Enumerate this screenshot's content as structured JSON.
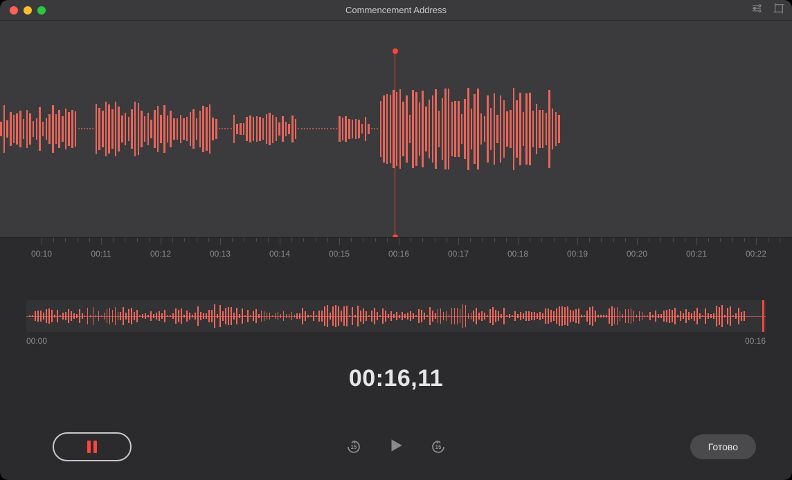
{
  "window": {
    "title": "Commencement Address"
  },
  "colors": {
    "accent": "#fc453c",
    "wave": "#fc6a5d",
    "bg": "#2b2b2d"
  },
  "ruler": {
    "labels": [
      "00:10",
      "00:11",
      "00:12",
      "00:13",
      "00:14",
      "00:15",
      "00:16",
      "00:17",
      "00:18",
      "00:19",
      "00:20",
      "00:21",
      "00:22"
    ]
  },
  "overview": {
    "start": "00:00",
    "end": "00:16"
  },
  "time_readout": "00:16,11",
  "controls": {
    "skip_back_seconds": "15",
    "skip_fwd_seconds": "15",
    "done_label": "Готово"
  }
}
